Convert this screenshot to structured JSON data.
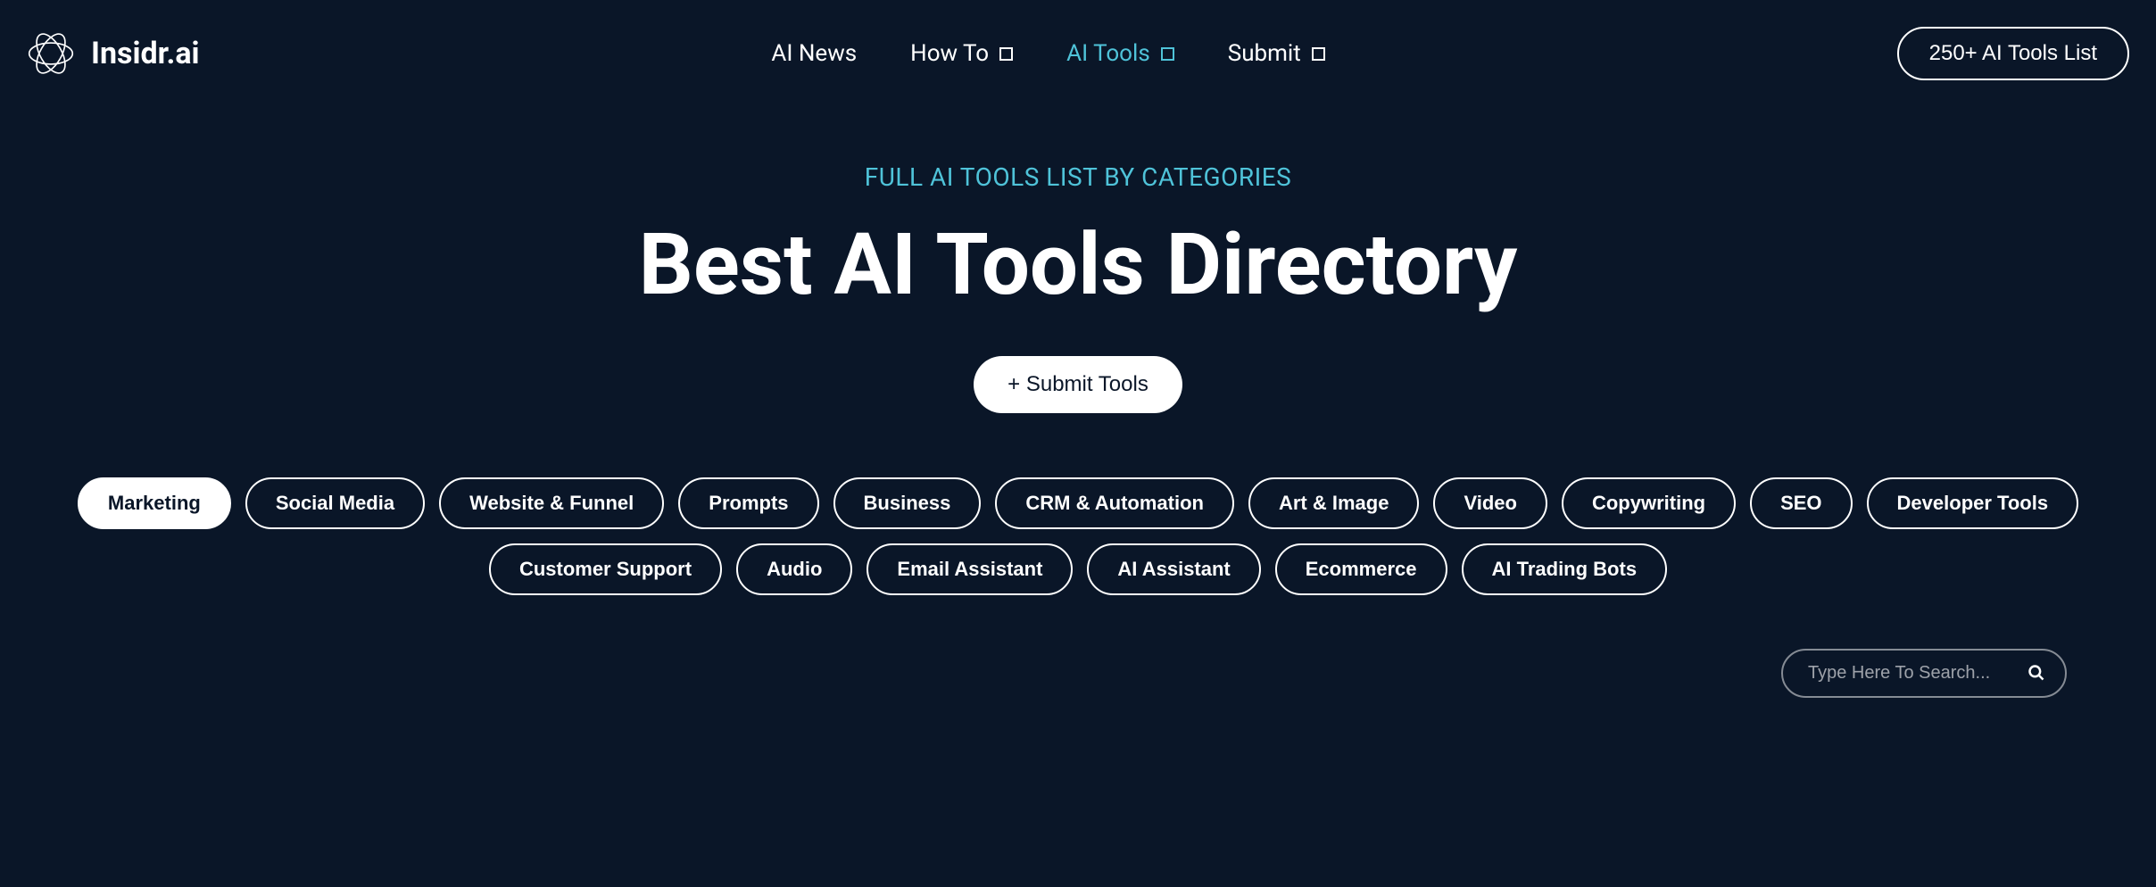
{
  "brand": "Insidr.ai",
  "nav": {
    "items": [
      {
        "label": "AI News",
        "hasDropdown": false,
        "active": false
      },
      {
        "label": "How To",
        "hasDropdown": true,
        "active": false
      },
      {
        "label": "AI Tools",
        "hasDropdown": true,
        "active": true
      },
      {
        "label": "Submit",
        "hasDropdown": true,
        "active": false
      }
    ],
    "cta": "250+ AI Tools List"
  },
  "hero": {
    "subtitle": "FULL AI TOOLS LIST BY CATEGORIES",
    "title": "Best AI Tools Directory",
    "submit": "+ Submit Tools"
  },
  "categories": [
    {
      "label": "Marketing",
      "active": true
    },
    {
      "label": "Social Media",
      "active": false
    },
    {
      "label": "Website & Funnel",
      "active": false
    },
    {
      "label": "Prompts",
      "active": false
    },
    {
      "label": "Business",
      "active": false
    },
    {
      "label": "CRM & Automation",
      "active": false
    },
    {
      "label": "Art & Image",
      "active": false
    },
    {
      "label": "Video",
      "active": false
    },
    {
      "label": "Copywriting",
      "active": false
    },
    {
      "label": "SEO",
      "active": false
    },
    {
      "label": "Developer Tools",
      "active": false
    },
    {
      "label": "Customer Support",
      "active": false
    },
    {
      "label": "Audio",
      "active": false
    },
    {
      "label": "Email Assistant",
      "active": false
    },
    {
      "label": "AI Assistant",
      "active": false
    },
    {
      "label": "Ecommerce",
      "active": false
    },
    {
      "label": "AI Trading Bots",
      "active": false
    }
  ],
  "search": {
    "placeholder": "Type Here To Search..."
  }
}
